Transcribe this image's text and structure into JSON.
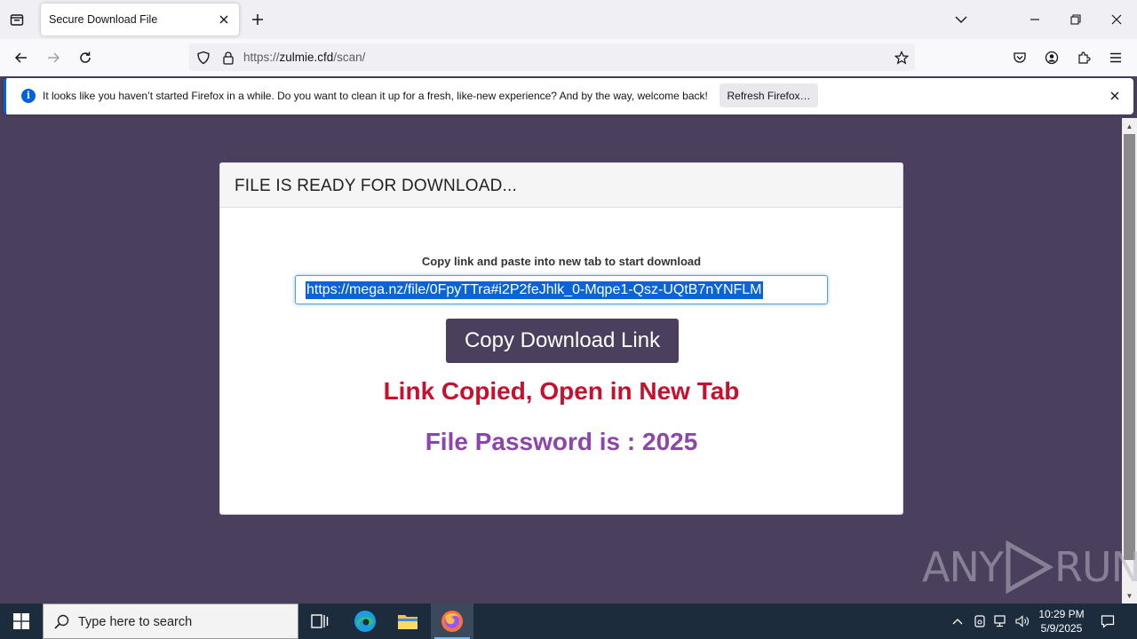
{
  "browser": {
    "tab_title": "Secure Download File",
    "url_prefix": "https://",
    "url_domain": "zulmie.cfd",
    "url_path": "/scan/"
  },
  "notification": {
    "message": "It looks like you haven’t started Firefox in a while. Do you want to clean it up for a fresh, like-new experience? And by the way, welcome back!",
    "button_label": "Refresh Firefox…"
  },
  "page": {
    "card_title": "FILE IS READY FOR DOWNLOAD...",
    "instruction": "Copy link and paste into new tab to start download",
    "download_link": "https://mega.nz/file/0FpyTTra#i2P2feJhlk_0-Mqpe1-Qsz-UQtB7nYNFLM",
    "copy_button_label": "Copy Download Link",
    "copied_message": "Link Copied, Open in New Tab",
    "password_message": "File Password is : 2025"
  },
  "watermark": {
    "left": "ANY",
    "right": "RUN"
  },
  "taskbar": {
    "search_placeholder": "Type here to search",
    "time": "10:29 PM",
    "date": "5/9/2025"
  },
  "colors": {
    "page_background": "#4a3f5c",
    "copied_text": "#c8102e",
    "password_text": "#8e44ad",
    "link_highlight": "#0a64d6"
  }
}
